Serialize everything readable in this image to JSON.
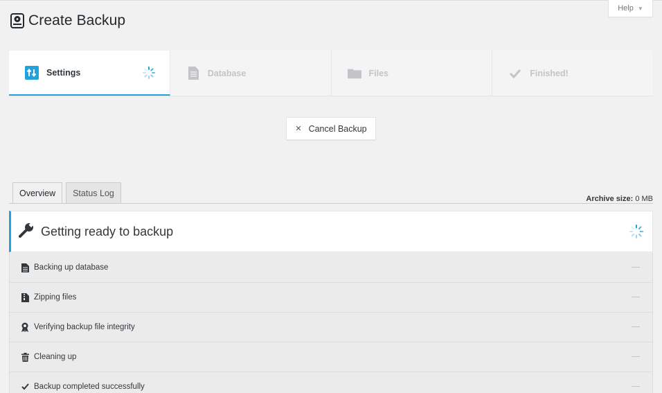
{
  "header": {
    "title": "Create Backup",
    "help_label": "Help"
  },
  "steps": [
    {
      "label": "Settings",
      "icon": "sort-arrows-icon",
      "state": "active"
    },
    {
      "label": "Database",
      "icon": "document-icon",
      "state": "pending"
    },
    {
      "label": "Files",
      "icon": "folder-icon",
      "state": "pending"
    },
    {
      "label": "Finished!",
      "icon": "checkmark-icon",
      "state": "pending"
    }
  ],
  "cancel_button": {
    "label": "Cancel Backup"
  },
  "tabs": [
    {
      "label": "Overview",
      "active": true
    },
    {
      "label": "Status Log",
      "active": false
    }
  ],
  "archive": {
    "label": "Archive size:",
    "value": "0 MB"
  },
  "status": {
    "title": "Getting ready to backup"
  },
  "tasks": [
    {
      "label": "Backing up database",
      "icon": "document-icon"
    },
    {
      "label": "Zipping files",
      "icon": "zip-file-icon"
    },
    {
      "label": "Verifying backup file integrity",
      "icon": "ribbon-award-icon"
    },
    {
      "label": "Cleaning up",
      "icon": "trash-icon"
    },
    {
      "label": "Backup completed successfully",
      "icon": "checkmark-icon"
    }
  ],
  "colors": {
    "accent": "#22a1db",
    "background": "#f1f1f1"
  }
}
